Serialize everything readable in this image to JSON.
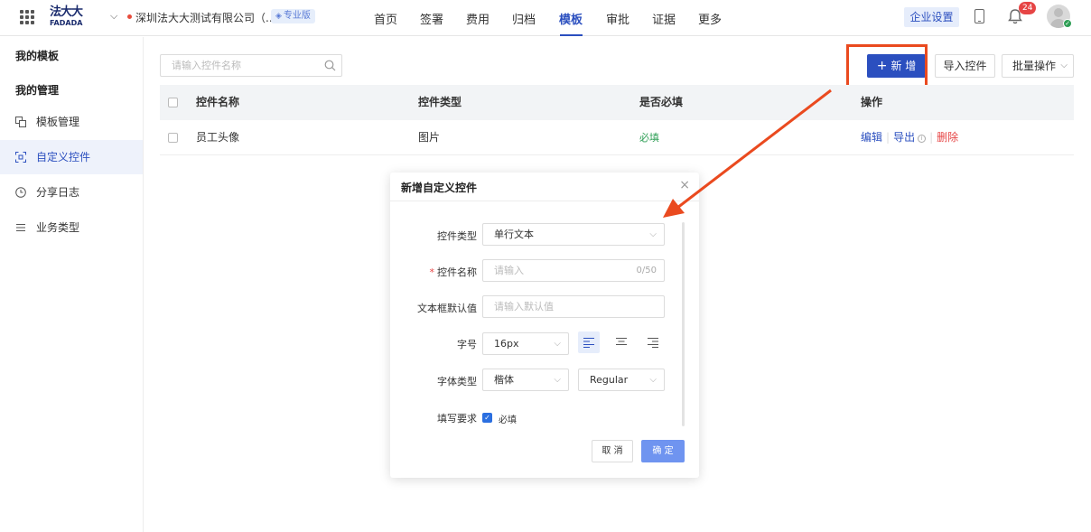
{
  "header": {
    "logo_cn": "法大大",
    "logo_en": "FADADA",
    "company_name": "深圳法大大测试有限公司（...",
    "edition_badge": "专业版",
    "nav": [
      "首页",
      "签署",
      "费用",
      "归档",
      "模板",
      "审批",
      "证据",
      "更多"
    ],
    "active_nav": "模板",
    "enterprise_settings": "企业设置",
    "notification_count": "24"
  },
  "sidebar": {
    "group_my_templates": "我的模板",
    "group_my_management": "我的管理",
    "items": [
      {
        "label": "模板管理",
        "icon": "template-icon"
      },
      {
        "label": "自定义控件",
        "icon": "scan-icon"
      },
      {
        "label": "分享日志",
        "icon": "clock-icon"
      },
      {
        "label": "业务类型",
        "icon": "list-icon"
      }
    ],
    "active_item": "自定义控件"
  },
  "toolbar": {
    "search_placeholder": "请输入控件名称",
    "new_label": "新 增",
    "import_label": "导入控件",
    "batch_label": "批量操作"
  },
  "table": {
    "columns": [
      "控件名称",
      "控件类型",
      "是否必填",
      "操作"
    ],
    "rows": [
      {
        "name": "员工头像",
        "type": "图片",
        "required": "必填",
        "actions": {
          "edit": "编辑",
          "export": "导出",
          "delete": "删除"
        }
      }
    ]
  },
  "modal": {
    "title": "新增自定义控件",
    "fields": {
      "control_type_label": "控件类型",
      "control_type_value": "单行文本",
      "control_name_label": "控件名称",
      "control_name_placeholder": "请输入",
      "control_name_counter": "0/50",
      "default_label": "文本框默认值",
      "default_placeholder": "请输入默认值",
      "font_size_label": "字号",
      "font_size_value": "16px",
      "font_type_label": "字体类型",
      "font_type_value": "楷体",
      "font_weight_value": "Regular",
      "requirement_label": "填写要求",
      "required_checkbox_label": "必填",
      "required_checked": true
    },
    "cancel_label": "取 消",
    "confirm_label": "确 定"
  },
  "colors": {
    "primary": "#2b4fbf",
    "annotation": "#ea4a1f",
    "success": "#2e9e55",
    "danger": "#e64545"
  }
}
